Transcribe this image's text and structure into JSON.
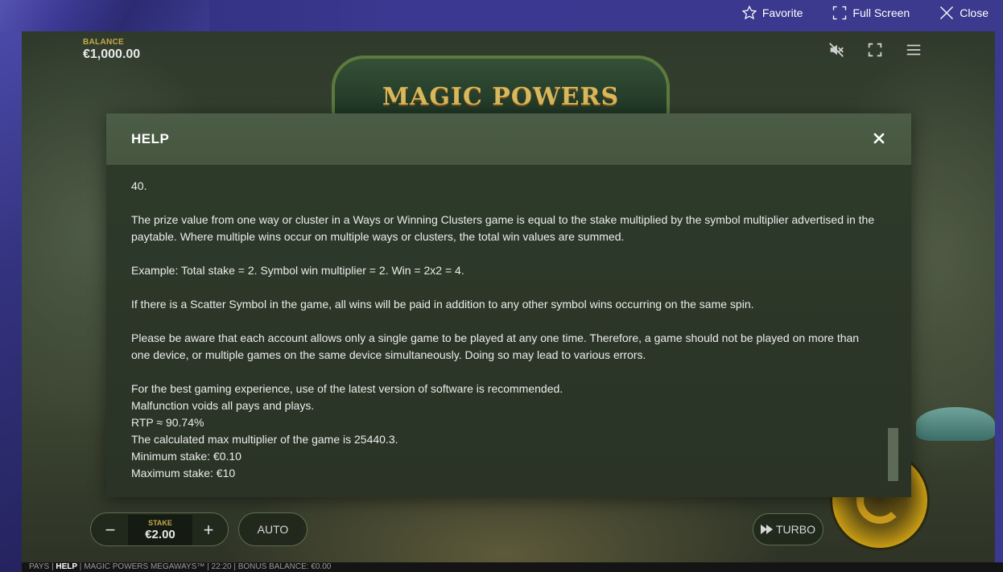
{
  "host": {
    "favorite_label": "Favorite",
    "fullscreen_label": "Full Screen",
    "close_label": "Close"
  },
  "game": {
    "logo_text": "MAGIC POWERS",
    "balance_label": "BALANCE",
    "balance_value": "€1,000.00",
    "icons": [
      "sound-muted-icon",
      "fullscreen-icon",
      "menu-icon"
    ]
  },
  "help": {
    "title": "HELP",
    "paragraphs": [
      "40.",
      "The prize value from one way or cluster in a Ways or Winning Clusters game is equal to the stake multiplied by the symbol multiplier advertised in the paytable. Where multiple wins occur on multiple ways or clusters, the total win values are summed.",
      "Example: Total stake = 2. Symbol win multiplier = 2. Win = 2x2 = 4.",
      "If there is a Scatter Symbol in the game, all wins will be paid in addition to any other symbol wins occurring on the same spin.",
      "Please be aware that each account allows only a single game to be played at any one time. Therefore, a game should not be played on more than one device, or multiple games on the same device simultaneously. Doing so may lead to various errors."
    ],
    "lines": [
      "For the best gaming experience, use of the latest version of software is recommended.",
      "Malfunction voids all pays and plays.",
      "RTP ≈ 90.74%",
      "The calculated max multiplier of the game is 25440.3.",
      "Minimum stake: €0.10",
      "Maximum stake: €10"
    ]
  },
  "controls": {
    "minus": "−",
    "plus": "+",
    "stake_label": "STAKE",
    "stake_value": "€2.00",
    "auto_label": "AUTO",
    "turbo_label": "TURBO"
  },
  "footer": {
    "pays": "PAYS",
    "help": "HELP",
    "game_name": "MAGIC POWERS MEGAWAYS™",
    "time": "22:20",
    "bonus_balance": "BONUS BALANCE: €0.00"
  },
  "colors": {
    "host_bar": "#3b3a8e",
    "dialog_header": "#4c5d47",
    "dialog_body": "#2e3b2a",
    "gold_label": "#c7a94a"
  }
}
